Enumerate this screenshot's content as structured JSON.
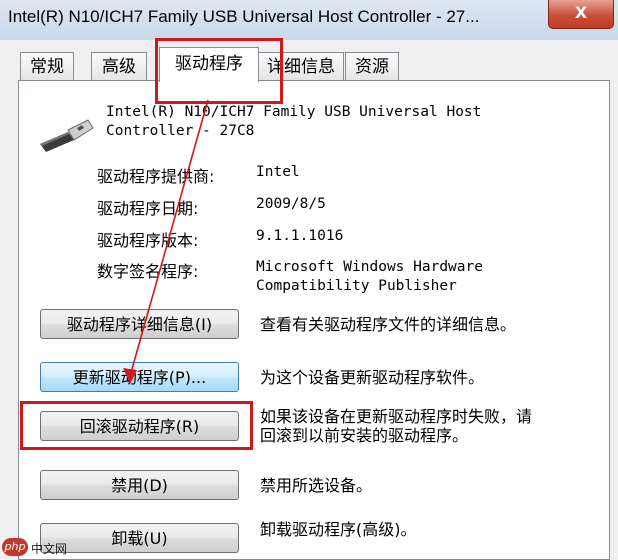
{
  "window": {
    "title": "Intel(R) N10/ICH7 Family USB Universal Host Controller - 27...",
    "close_label": "X"
  },
  "tabs": [
    {
      "label": "常规"
    },
    {
      "label": "高级"
    },
    {
      "label": "驱动程序",
      "active": true
    },
    {
      "label": "详细信息"
    },
    {
      "label": "资源"
    }
  ],
  "device": {
    "icon": "usb-plug-icon",
    "name": "Intel(R) N10/ICH7 Family USB Universal Host\nController - 27C8"
  },
  "info": {
    "provider_label": "驱动程序提供商:",
    "provider_value": "Intel",
    "date_label": "驱动程序日期:",
    "date_value": "2009/8/5",
    "version_label": "驱动程序版本:",
    "version_value": "9.1.1.1016",
    "signer_label": "数字签名程序:",
    "signer_value": "Microsoft Windows Hardware\nCompatibility Publisher"
  },
  "buttons": {
    "details_label": "驱动程序详细信息(I)",
    "details_desc": "查看有关驱动程序文件的详细信息。",
    "update_label": "更新驱动程序(P)...",
    "update_desc": "为这个设备更新驱动程序软件。",
    "rollback_label": "回滚驱动程序(R)",
    "rollback_desc": "如果该设备在更新驱动程序时失败，请\n回滚到以前安装的驱动程序。",
    "disable_label": "禁用(D)",
    "disable_desc": "禁用所选设备。",
    "uninstall_label": "卸载(U)",
    "uninstall_desc": "卸载驱动程序(高级)。"
  },
  "watermark": {
    "logo": "php",
    "text": "中文网"
  },
  "colors": {
    "annotation_red": "#d01818",
    "close_red": "#c8503a",
    "highlight_blue": "#bee6fd"
  }
}
